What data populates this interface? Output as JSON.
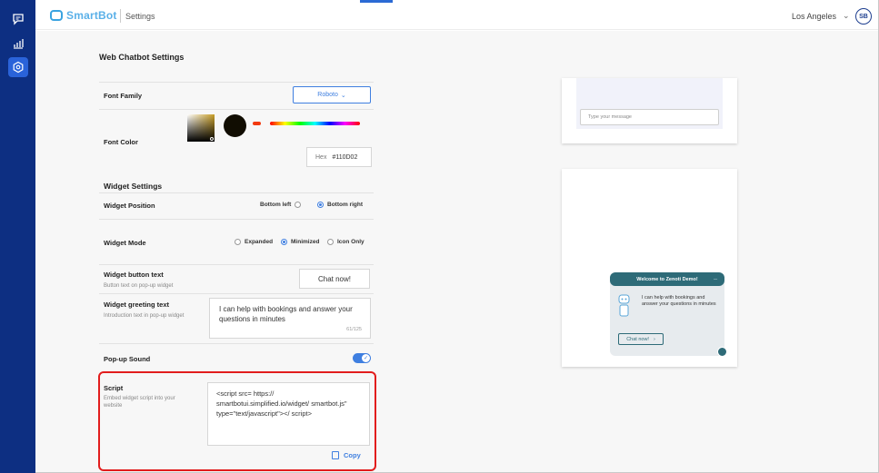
{
  "header": {
    "brand": "SmartBot",
    "section": "Settings",
    "location": "Los Angeles",
    "avatar_initials": "SB"
  },
  "sidebar": {
    "items": [
      {
        "icon": "chat-icon",
        "active": false
      },
      {
        "icon": "analytics-icon",
        "active": false
      },
      {
        "icon": "settings-icon",
        "active": true
      }
    ]
  },
  "page": {
    "title": "Web Chatbot Settings"
  },
  "font": {
    "family_label": "Font Family",
    "family_value": "Roboto",
    "color_label": "Font Color",
    "hex_label": "Hex",
    "hex_value": "#110D02",
    "color": "#110D02"
  },
  "widget": {
    "section_title": "Widget Settings",
    "position_label": "Widget Position",
    "position_options": [
      "Bottom left",
      "Bottom right"
    ],
    "position_selected": "Bottom right",
    "mode_label": "Widget Mode",
    "mode_options": [
      "Expanded",
      "Minimized",
      "Icon Only"
    ],
    "mode_selected": "Minimized",
    "button_text_label": "Widget button text",
    "button_text_sub": "Button text on pop-up widget",
    "button_text_value": "Chat now!",
    "greeting_label": "Widget greeting text",
    "greeting_sub": "Introduction text in pop-up widget",
    "greeting_value": "I can help with bookings and answer your questions in minutes",
    "greeting_count": "61/125",
    "popup_sound_label": "Pop-up Sound",
    "popup_sound_on": true,
    "script_label": "Script",
    "script_sub": "Embed widget script into your website",
    "script_value": "<script src= https:// smartbotui.simplified.io/widget/ smartbot.js\" type=\"text/javascript\"></ script>",
    "copy_label": "Copy"
  },
  "preview": {
    "message_placeholder": "Type your message",
    "widget_title": "Welcome to Zenoti Demo!",
    "minimize": "_",
    "widget_text": "I can help with bookings and answer your questions in minutes",
    "widget_button": "Chat now!"
  },
  "colors": {
    "sidebar": "#0d2f82",
    "accent": "#3f7fe0",
    "highlight": "#e21d1d",
    "widget": "#2e6b78"
  }
}
